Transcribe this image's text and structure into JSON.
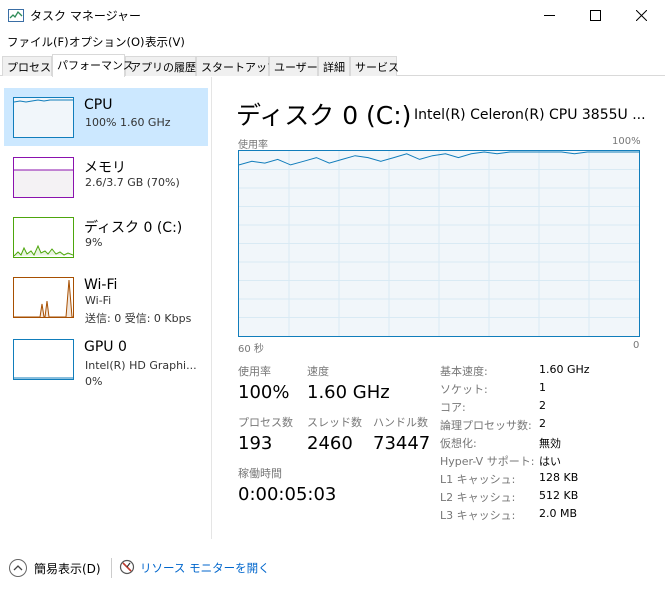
{
  "window": {
    "title": "タスク マネージャー"
  },
  "menu": [
    "ファイル(F)",
    "オプション(O)",
    "表示(V)"
  ],
  "tabs": [
    "プロセス",
    "パフォーマンス",
    "アプリの履歴",
    "スタートアップ",
    "ユーザー",
    "詳細",
    "サービス"
  ],
  "sidebar": {
    "items": [
      {
        "title": "CPU",
        "sub1": "100%  1.60 GHz",
        "color": "#117dbb"
      },
      {
        "title": "メモリ",
        "sub1": "2.6/3.7 GB (70%)",
        "color": "#8b12ae"
      },
      {
        "title": "ディスク 0 (C:)",
        "sub1": "9%",
        "color": "#4da60c"
      },
      {
        "title": "Wi-Fi",
        "sub1": "Wi-Fi",
        "sub2": "送信: 0 受信: 0 Kbps",
        "color": "#a74f01"
      },
      {
        "title": "GPU 0",
        "sub1": "Intel(R) HD Graphi...",
        "sub2": "0%",
        "color": "#117dbb"
      }
    ]
  },
  "main": {
    "title": "ディスク 0 (C:)",
    "model": "Intel(R) Celeron(R) CPU 3855U ...",
    "graph": {
      "top_left": "使用率",
      "top_right": "100%",
      "bottom_left": "60 秒",
      "bottom_right": "0",
      "usage_series": [
        93,
        95,
        94,
        96,
        93,
        95,
        97,
        94,
        96,
        98,
        97,
        95,
        97,
        99,
        96,
        98,
        99,
        97,
        99,
        100,
        99,
        100,
        100,
        100,
        100,
        100,
        99,
        100,
        100,
        100,
        100,
        100
      ]
    },
    "stats": {
      "usage_label": "使用率",
      "usage_value": "100%",
      "speed_label": "速度",
      "speed_value": "1.60 GHz",
      "proc_label": "プロセス数",
      "proc_value": "193",
      "thread_label": "スレッド数",
      "thread_value": "2460",
      "handle_label": "ハンドル数",
      "handle_value": "73447",
      "uptime_label": "稼働時間",
      "uptime_value": "0:00:05:03"
    },
    "info": [
      {
        "label": "基本速度:",
        "value": "1.60 GHz"
      },
      {
        "label": "ソケット:",
        "value": "1"
      },
      {
        "label": "コア:",
        "value": "2"
      },
      {
        "label": "論理プロセッサ数:",
        "value": "2"
      },
      {
        "label": "仮想化:",
        "value": "無効"
      },
      {
        "label": "Hyper-V サポート:",
        "value": "はい"
      },
      {
        "label": "L1 キャッシュ:",
        "value": "128 KB"
      },
      {
        "label": "L2 キャッシュ:",
        "value": "512 KB"
      },
      {
        "label": "L3 キャッシュ:",
        "value": "2.0 MB"
      }
    ]
  },
  "bottom": {
    "fewer_details": "簡易表示(D)",
    "open_resmon": "リソース モニターを開く"
  }
}
